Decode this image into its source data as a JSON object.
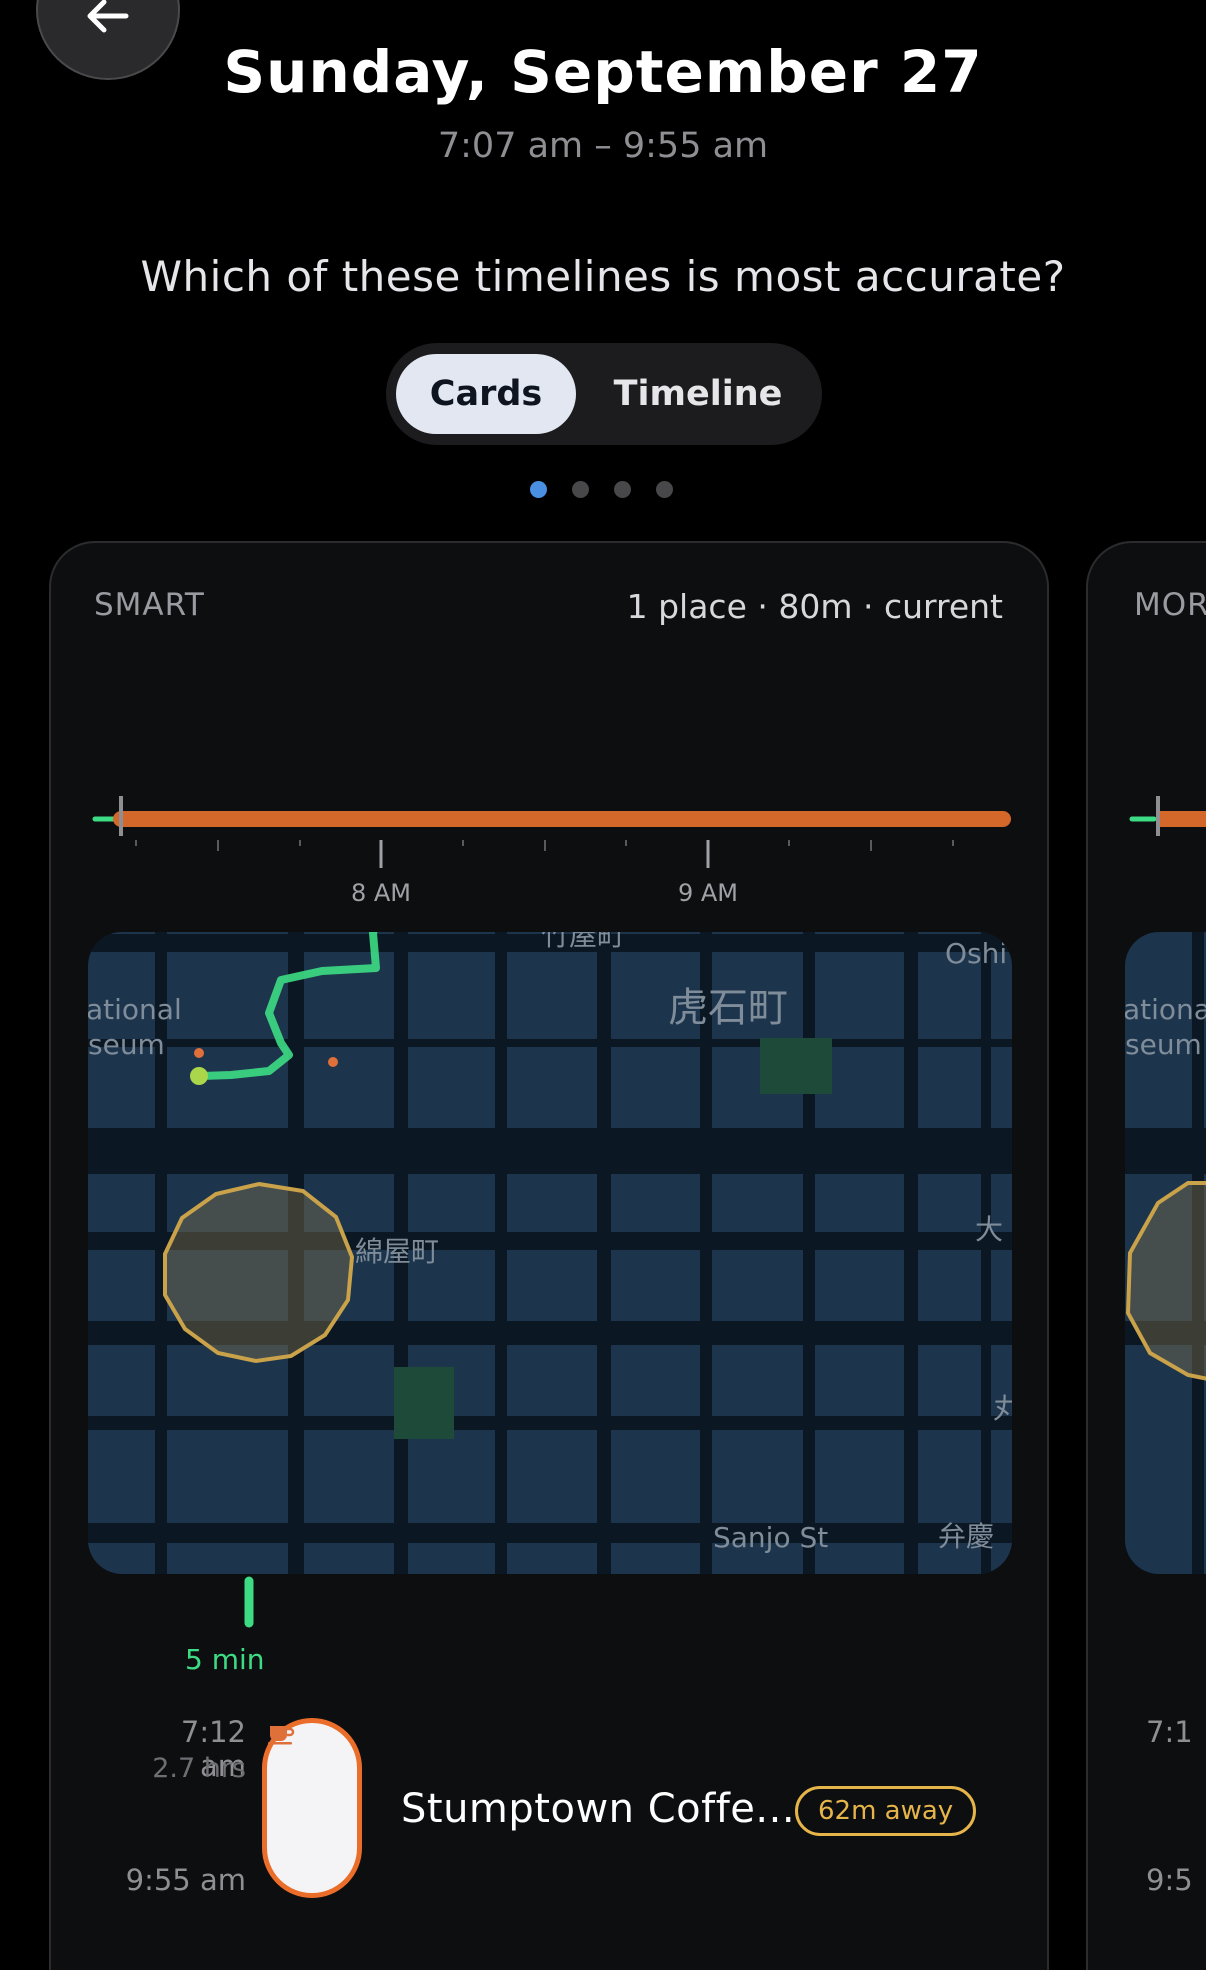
{
  "header": {
    "title": "Sunday, September 27",
    "time_range": "7:07 am – 9:55 am",
    "question": "Which of these timelines is most accurate?"
  },
  "view_toggle": {
    "options": [
      "Cards",
      "Timeline"
    ],
    "selected": "Cards"
  },
  "pager": {
    "count": 4,
    "active_index": 0,
    "active_color": "#4a90e2"
  },
  "cards": [
    {
      "label": "SMART",
      "summary": "1 place · 80m · current",
      "timebar": {
        "ticks": [
          "8 AM",
          "9 AM"
        ],
        "bar_color": "#d4672a",
        "travel_color": "#3ddc84"
      },
      "map": {
        "labels": [
          "竹屋町",
          "虎石町",
          "Oshi",
          "ational",
          "seum",
          "綿屋町",
          "大",
          "丸",
          "Sanjo St",
          "弁慶"
        ]
      },
      "segment": {
        "duration": "5 min",
        "start_time": "7:12 am",
        "length": "2.7 hrs",
        "end_time": "9:55 am",
        "place_icon": "coffee-cup-icon",
        "place_name": "Stumptown Coffe...",
        "distance": "62m away"
      }
    },
    {
      "label": "MORE",
      "map_labels": [
        "ational",
        "seum"
      ],
      "segment": {
        "start_time": "7:1",
        "end_time": "9:5"
      }
    }
  ]
}
